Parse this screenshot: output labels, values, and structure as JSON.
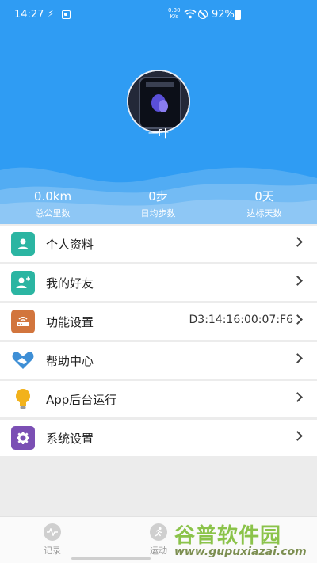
{
  "status_bar": {
    "time": "14:27",
    "net_speed_value": "0.30",
    "net_speed_unit": "K/s",
    "battery": "92%"
  },
  "profile": {
    "name": "一叶"
  },
  "stats": [
    {
      "value": "0.0km",
      "label": "总公里数"
    },
    {
      "value": "0步",
      "label": "日均步数"
    },
    {
      "value": "0天",
      "label": "达标天数"
    }
  ],
  "menu": [
    {
      "label": "个人资料",
      "icon": "user-icon",
      "color": "#2bb5a2",
      "value": ""
    },
    {
      "label": "我的好友",
      "icon": "add-friend-icon",
      "color": "#2bb5a2",
      "value": ""
    },
    {
      "label": "功能设置",
      "icon": "router-icon",
      "color": "#d2753d",
      "value": "D3:14:16:00:07:F6"
    },
    {
      "label": "帮助中心",
      "icon": "handshake-heart-icon",
      "color": "#3e8fd6",
      "value": ""
    },
    {
      "label": "App后台运行",
      "icon": "lightbulb-icon",
      "color": "#f2b21b",
      "value": ""
    },
    {
      "label": "系统设置",
      "icon": "gear-icon",
      "color": "#7b4fb4",
      "value": ""
    }
  ],
  "tabs": [
    {
      "label": "记录",
      "icon": "activity-icon"
    },
    {
      "label": "运动",
      "icon": "running-icon"
    }
  ],
  "watermark": {
    "top": "谷普软件园",
    "bottom": "www.gupuxiazai.com"
  }
}
